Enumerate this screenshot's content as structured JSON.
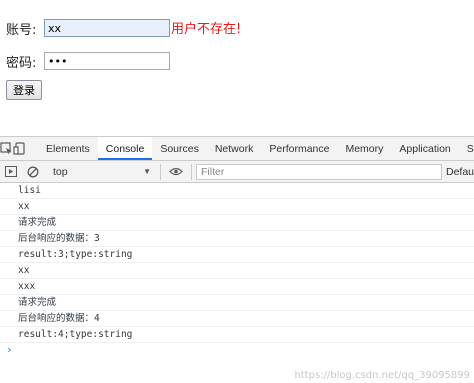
{
  "form": {
    "account_label": "账号:",
    "account_value": "xx",
    "error_message": "用户不存在!",
    "password_label": "密码:",
    "password_value": "•••",
    "login_button": "登录"
  },
  "devtools": {
    "tabs": [
      "Elements",
      "Console",
      "Sources",
      "Network",
      "Performance",
      "Memory",
      "Application",
      "Se"
    ],
    "active_tab": "Console",
    "context": "top",
    "filter_placeholder": "Filter",
    "levels_label": "Defau"
  },
  "console": {
    "lines": [
      "lisi",
      "xx",
      "请求完成",
      "后台响应的数据：3",
      "result:3;type:string",
      "xx",
      "xxx",
      "请求完成",
      "后台响应的数据：4",
      "result:4;type:string"
    ],
    "prompt": "›"
  },
  "watermark": "https://blog.csdn.net/qq_39095899"
}
